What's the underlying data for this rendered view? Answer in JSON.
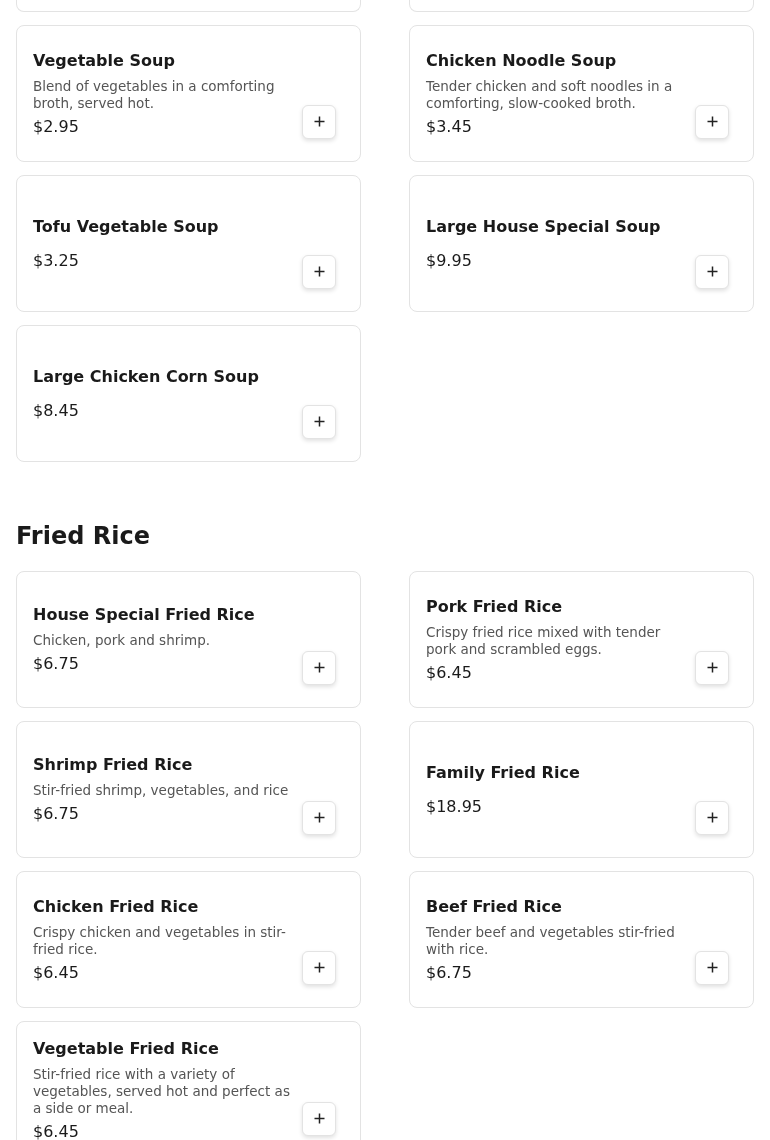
{
  "sections": [
    {
      "items": [
        {
          "name": "Vegetable Soup",
          "description": "Blend of vegetables in a comforting broth, served hot.",
          "price": "$2.95"
        },
        {
          "name": "Chicken Noodle Soup",
          "description": "Tender chicken and soft noodles in a comforting, slow-cooked broth.",
          "price": "$3.45"
        },
        {
          "name": "Tofu Vegetable Soup",
          "price": "$3.25"
        },
        {
          "name": "Large House Special Soup",
          "price": "$9.95"
        },
        {
          "name": "Large Chicken Corn Soup",
          "price": "$8.45"
        }
      ]
    },
    {
      "title": "Fried Rice",
      "items": [
        {
          "name": "House Special Fried Rice",
          "description": "Chicken, pork and shrimp.",
          "price": "$6.75"
        },
        {
          "name": "Pork Fried Rice",
          "description": "Crispy fried rice mixed with tender pork and scrambled eggs.",
          "price": "$6.45"
        },
        {
          "name": "Shrimp Fried Rice",
          "description": "Stir-fried shrimp, vegetables, and rice",
          "price": "$6.75"
        },
        {
          "name": "Family Fried Rice",
          "price": "$18.95"
        },
        {
          "name": "Chicken Fried Rice",
          "description": "Crispy chicken and vegetables in stir-fried rice.",
          "price": "$6.45"
        },
        {
          "name": "Beef Fried Rice",
          "description": "Tender beef and vegetables stir-fried with rice.",
          "price": "$6.75"
        },
        {
          "name": "Vegetable Fried Rice",
          "description": "Stir-fried rice with a variety of vegetables, served hot and perfect as a side or meal.",
          "price": "$6.45"
        }
      ]
    }
  ]
}
